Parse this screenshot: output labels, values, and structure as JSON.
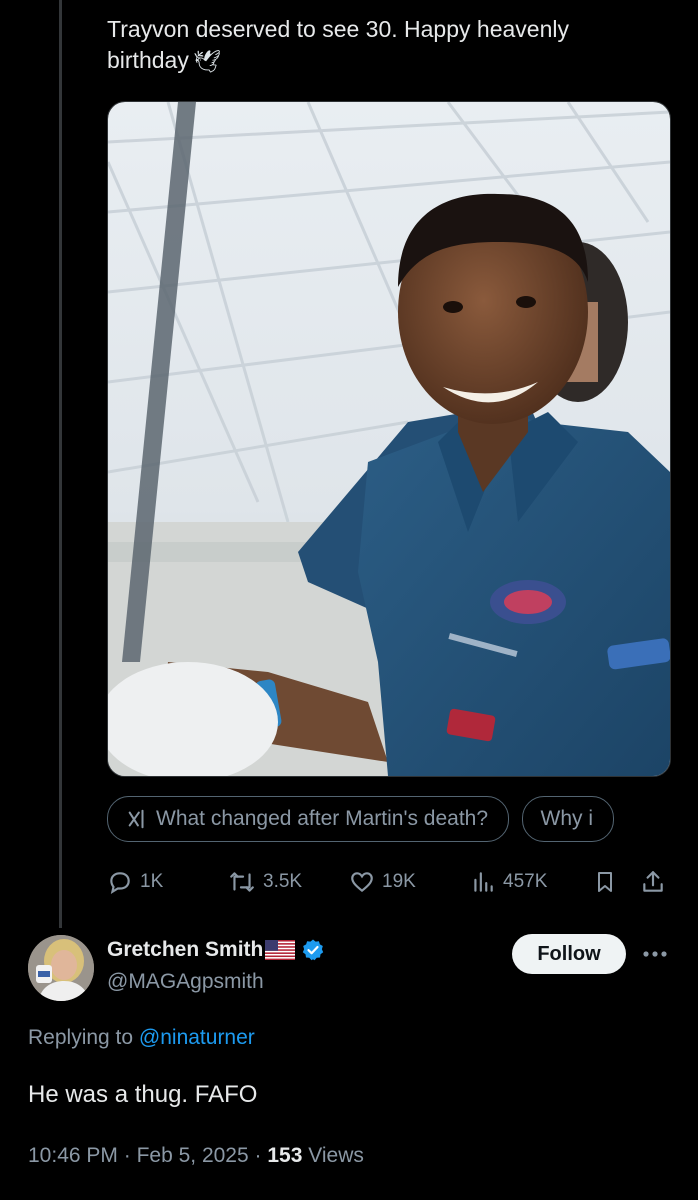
{
  "original_tweet": {
    "text": "Trayvon deserved to see 30. Happy heavenly birthday",
    "text_line1": "Trayvon deserved to see 30. Happy heavenly",
    "text_line2": "birthday",
    "emoji": "🕊",
    "grok_prompts": [
      "What changed after Martin's death?",
      "Why i"
    ],
    "stats": {
      "replies": "1K",
      "reposts": "3.5K",
      "likes": "19K",
      "views": "457K"
    }
  },
  "reply": {
    "display_name": "Gretchen Smith",
    "flag": "🇺🇸",
    "handle": "@MAGAgpsmith",
    "follow_label": "Follow",
    "replying_prefix": "Replying to",
    "replying_to": "@ninaturner",
    "text": "He was a thug. FAFO",
    "time": "10:46 PM",
    "separator": "·",
    "date": "Feb 5, 2025",
    "views_count": "153",
    "views_label": "Views"
  },
  "colors": {
    "background": "#000000",
    "text_primary": "#e7e9ea",
    "text_secondary": "#8b98a5",
    "link": "#1d9bf0",
    "verified": "#1d9bf0",
    "follow_button_bg": "#eff3f4"
  },
  "icons": [
    "grok-icon",
    "reply-icon",
    "repost-icon",
    "like-icon",
    "views-icon",
    "bookmark-icon",
    "share-icon",
    "verified-icon",
    "more-icon"
  ]
}
